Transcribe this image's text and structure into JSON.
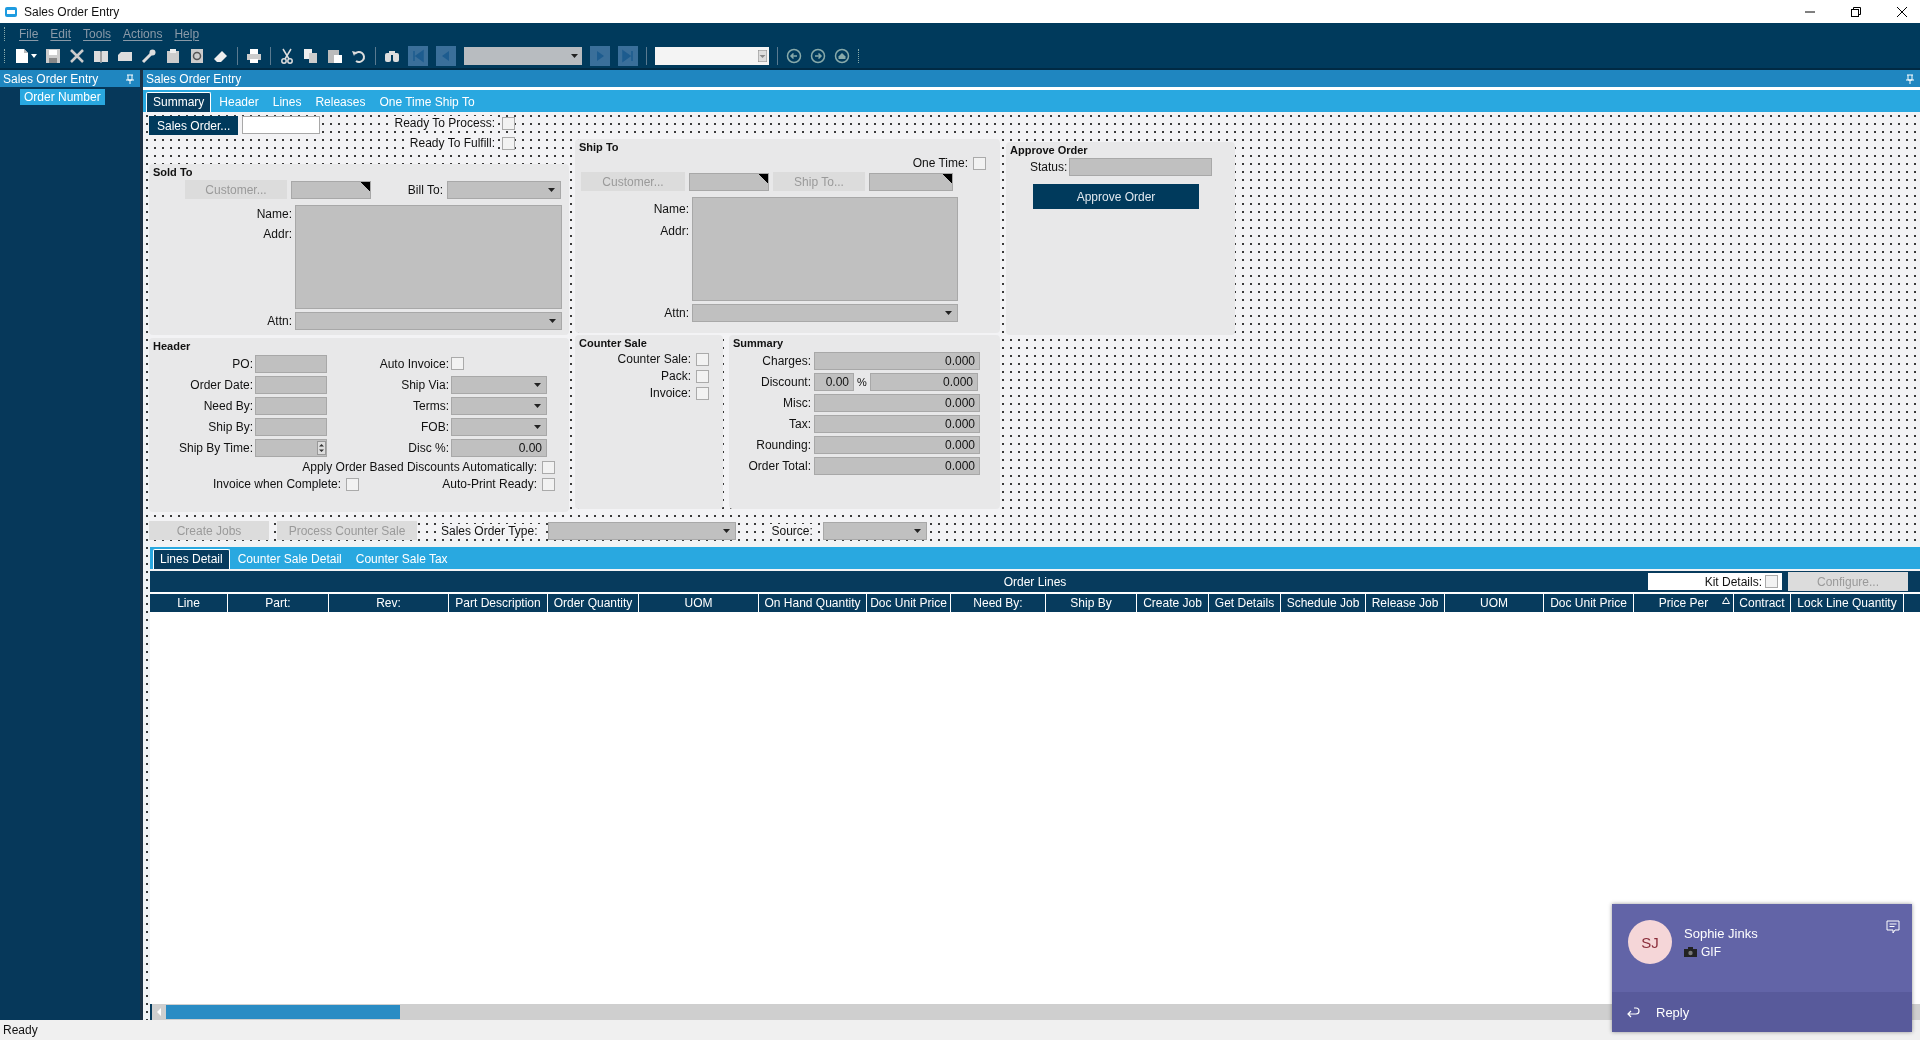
{
  "window": {
    "title": "Sales Order Entry"
  },
  "menu": [
    "File",
    "Edit",
    "Tools",
    "Actions",
    "Help"
  ],
  "left_pane": {
    "title": "Sales Order Entry",
    "items": [
      {
        "label": "Order Number",
        "selected": true
      }
    ]
  },
  "main": {
    "title": "Sales Order Entry",
    "tabs": [
      {
        "label": "Summary",
        "selected": true
      },
      {
        "label": "Header",
        "selected": false
      },
      {
        "label": "Lines",
        "selected": false
      },
      {
        "label": "Releases",
        "selected": false
      },
      {
        "label": "One Time Ship To",
        "selected": false
      }
    ]
  },
  "form": {
    "sales_order_button": {
      "label": "Sales Order...",
      "disabled": false
    },
    "ready": [
      {
        "label": "Ready To Process:",
        "checked": false
      },
      {
        "label": "Ready To Fulfill:",
        "checked": false
      }
    ],
    "sold_to": {
      "title": "Sold To",
      "customer_button": {
        "label": "Customer...",
        "disabled": true
      },
      "bill_to_label": "Bill To:",
      "name_label": "Name:",
      "addr_label": "Addr:",
      "attn_label": "Attn:"
    },
    "ship_to": {
      "title": "Ship To",
      "one_time": {
        "label": "One Time:",
        "checked": false
      },
      "customer_button": {
        "label": "Customer...",
        "disabled": true
      },
      "ship_to_button": {
        "label": "Ship To...",
        "disabled": true
      },
      "name_label": "Name:",
      "addr_label": "Addr:",
      "attn_label": "Attn:"
    },
    "approve_order": {
      "title": "Approve Order",
      "status_label": "Status:",
      "button": {
        "label": "Approve Order",
        "disabled": false
      }
    },
    "header": {
      "title": "Header",
      "left": [
        {
          "label": "PO:",
          "kind": "text"
        },
        {
          "label": "Order Date:",
          "kind": "text"
        },
        {
          "label": "Need By:",
          "kind": "text"
        },
        {
          "label": "Ship By:",
          "kind": "text"
        },
        {
          "label": "Ship By Time:",
          "kind": "spin"
        }
      ],
      "right": [
        {
          "label": "Auto Invoice:",
          "kind": "checkbox",
          "checked": false
        },
        {
          "label": "Ship Via:",
          "kind": "combo"
        },
        {
          "label": "Terms:",
          "kind": "combo"
        },
        {
          "label": "FOB:",
          "kind": "combo"
        },
        {
          "label": "Disc %:",
          "kind": "number",
          "value": "0.00"
        }
      ],
      "apply_discounts": {
        "label": "Apply Order Based Discounts Automatically:",
        "checked": false
      },
      "invoice_when_complete": {
        "label": "Invoice when Complete:",
        "checked": false
      },
      "auto_print_ready": {
        "label": "Auto-Print Ready:",
        "checked": false
      }
    },
    "counter_sale": {
      "title": "Counter Sale",
      "options": [
        {
          "label": "Counter Sale:",
          "checked": false
        },
        {
          "label": "Pack:",
          "checked": false
        },
        {
          "label": "Invoice:",
          "checked": false
        }
      ]
    },
    "summary": {
      "title": "Summary",
      "rows": [
        {
          "label": "Charges:",
          "value": "0.000"
        },
        {
          "label": "Discount:",
          "percent": "0.00",
          "percent_sign": "%",
          "value": "0.000"
        },
        {
          "label": "Misc:",
          "value": "0.000"
        },
        {
          "label": "Tax:",
          "value": "0.000"
        },
        {
          "label": "Rounding:",
          "value": "0.000"
        },
        {
          "label": "Order Total:",
          "value": "0.000"
        }
      ]
    },
    "actions": {
      "create_jobs": {
        "label": "Create Jobs",
        "disabled": true
      },
      "process_counter_sale": {
        "label": "Process Counter Sale",
        "disabled": true
      },
      "sales_order_type_label": "Sales Order Type:",
      "source_label": "Source:"
    }
  },
  "detail_tabs": [
    {
      "label": "Lines Detail",
      "selected": true
    },
    {
      "label": "Counter Sale Detail",
      "selected": false
    },
    {
      "label": "Counter Sale Tax",
      "selected": false
    }
  ],
  "order_lines": {
    "title": "Order Lines",
    "kit_details": {
      "label": "Kit Details:",
      "checked": false
    },
    "configure_button": {
      "label": "Configure...",
      "disabled": true
    },
    "columns": [
      {
        "label": "Line",
        "sorted": false
      },
      {
        "label": "Part:",
        "sorted": false
      },
      {
        "label": "Rev:",
        "sorted": false
      },
      {
        "label": "Part Description",
        "sorted": false
      },
      {
        "label": "Order Quantity",
        "sorted": false
      },
      {
        "label": "UOM",
        "sorted": false
      },
      {
        "label": "On Hand Quantity",
        "sorted": false
      },
      {
        "label": "Doc Unit Price",
        "sorted": false
      },
      {
        "label": "Need By:",
        "sorted": false
      },
      {
        "label": "Ship By",
        "sorted": false
      },
      {
        "label": "Create Job",
        "sorted": false
      },
      {
        "label": "Get Details",
        "sorted": false
      },
      {
        "label": "Schedule Job",
        "sorted": false
      },
      {
        "label": "Release Job",
        "sorted": false
      },
      {
        "label": "UOM",
        "sorted": false
      },
      {
        "label": "Doc Unit Price",
        "sorted": false
      },
      {
        "label": "Price Per",
        "sorted": true
      },
      {
        "label": "Contract",
        "sorted": false
      },
      {
        "label": "Lock Line Quantity",
        "sorted": false
      }
    ]
  },
  "status_bar": {
    "text": "Ready"
  },
  "notification": {
    "sender": "Sophie Jinks",
    "initials": "SJ",
    "message": "GIF",
    "reply": "Reply"
  }
}
